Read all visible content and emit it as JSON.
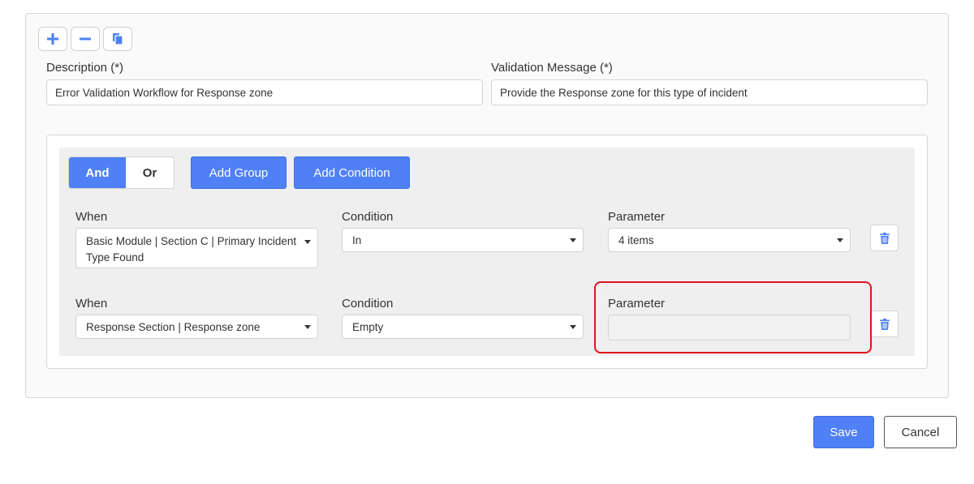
{
  "toolbar": {
    "add_icon": "plus-icon",
    "remove_icon": "minus-icon",
    "copy_icon": "copy-icon"
  },
  "form": {
    "description_label": "Description (*)",
    "description_value": "Error Validation Workflow for Response zone",
    "validation_label": "Validation Message (*)",
    "validation_value": "Provide the Response zone for this type of incident"
  },
  "rules": {
    "and_label": "And",
    "or_label": "Or",
    "add_group_label": "Add Group",
    "add_condition_label": "Add Condition",
    "rows": [
      {
        "when_label": "When",
        "when_value": "Basic Module | Section C | Primary Incident Type Found",
        "condition_label": "Condition",
        "condition_value": "In",
        "parameter_label": "Parameter",
        "parameter_value": "4 items"
      },
      {
        "when_label": "When",
        "when_value": "Response Section | Response zone",
        "condition_label": "Condition",
        "condition_value": "Empty",
        "parameter_label": "Parameter",
        "parameter_value": ""
      }
    ]
  },
  "actions": {
    "save_label": "Save",
    "cancel_label": "Cancel"
  },
  "colors": {
    "primary": "#4f80f5",
    "highlight": "#e3121f"
  }
}
